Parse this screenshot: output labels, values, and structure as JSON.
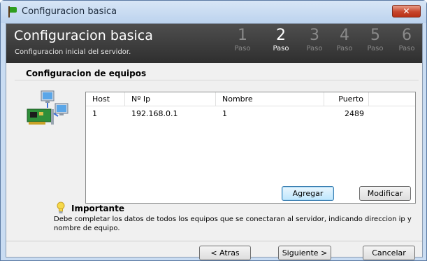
{
  "window": {
    "title": "Configuracion basica",
    "close_glyph": "✕"
  },
  "header": {
    "title": "Configuracion basica",
    "subtitle": "Configuracion inicial del servidor."
  },
  "steps": [
    {
      "num": "1",
      "label": "Paso"
    },
    {
      "num": "2",
      "label": "Paso"
    },
    {
      "num": "3",
      "label": "Paso"
    },
    {
      "num": "4",
      "label": "Paso"
    },
    {
      "num": "5",
      "label": "Paso"
    },
    {
      "num": "6",
      "label": "Paso"
    }
  ],
  "current_step": 2,
  "section": {
    "title": "Configuracion de equipos"
  },
  "table": {
    "columns": [
      "Host",
      "Nº Ip",
      "Nombre",
      "Puerto"
    ],
    "rows": [
      [
        "1",
        "192.168.0.1",
        "1",
        "2489"
      ]
    ]
  },
  "actions": {
    "add_label": "Agregar",
    "modify_label": "Modificar"
  },
  "notice": {
    "title": "Importante",
    "text": "Debe completar los datos de todos los equipos que se conectaran al servidor, indicando direccion ip y nombre de equipo."
  },
  "footer": {
    "back_label": "< Atras",
    "next_label": "Siguiente >",
    "cancel_label": "Cancelar"
  },
  "icons": {
    "app": "flag-icon",
    "close": "close-icon",
    "network": "network-computers-icon",
    "tip": "lightbulb-icon"
  },
  "colors": {
    "header_bg": "#3a3a3a",
    "close_red": "#c7452c",
    "primary_button": "#bee6fd"
  }
}
